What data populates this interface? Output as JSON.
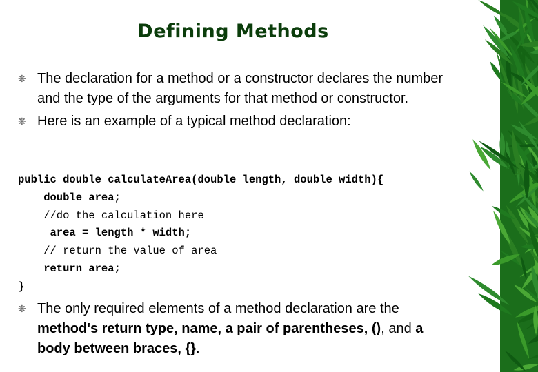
{
  "slide": {
    "title": "Defining Methods",
    "bullet_icon": "asterisk-bullet-icon",
    "accent_color": "#0b3d0b",
    "decoration": "bamboo-leaves",
    "bullets_top": [
      "The declaration for a method or a constructor declares the number and the type of the arguments for that method or constructor.",
      "Here is an example of a typical method declaration:"
    ],
    "code_lines": [
      {
        "text": "public double calculateArea(double length, double width){",
        "style": "bold",
        "indent": ""
      },
      {
        "text": "double area;",
        "style": "bold",
        "indent": "    "
      },
      {
        "text": "//do the calculation here",
        "style": "comment",
        "indent": "    "
      },
      {
        "text": "area = length * width;",
        "style": "bold",
        "indent": "     "
      },
      {
        "text": "// return the value of area",
        "style": "comment",
        "indent": "    "
      },
      {
        "text": "return area;",
        "style": "bold",
        "indent": "    "
      },
      {
        "text": "}",
        "style": "bold",
        "indent": ""
      }
    ],
    "bullet_bottom": {
      "parts": [
        {
          "text": "The only required elements of a method declaration are the ",
          "bold": false
        },
        {
          "text": "method's return type, name, a pair of parentheses, ()",
          "bold": true
        },
        {
          "text": ", and ",
          "bold": false
        },
        {
          "text": "a body between braces, {}",
          "bold": true
        },
        {
          "text": ".",
          "bold": false
        }
      ]
    }
  }
}
